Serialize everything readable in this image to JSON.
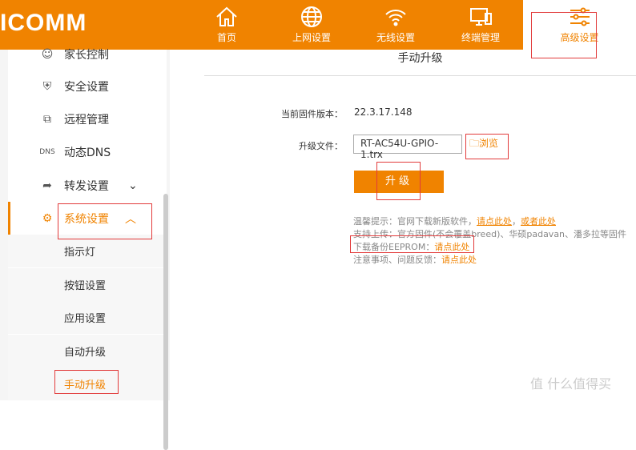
{
  "header": {
    "logo": "ICOMM",
    "nav": [
      {
        "label": "首页",
        "icon": "home-icon"
      },
      {
        "label": "上网设置",
        "icon": "globe-icon"
      },
      {
        "label": "无线设置",
        "icon": "wifi-icon"
      },
      {
        "label": "终端管理",
        "icon": "devices-icon"
      },
      {
        "label": "高级设置",
        "icon": "sliders-icon",
        "active": true
      }
    ]
  },
  "sidebar": {
    "items": [
      {
        "label": "家长控制",
        "icon": "parent-icon"
      },
      {
        "label": "安全设置",
        "icon": "shield-icon"
      },
      {
        "label": "远程管理",
        "icon": "remote-icon"
      },
      {
        "label": "动态DNS",
        "icon": "DNS"
      },
      {
        "label": "转发设置",
        "icon": "forward-icon"
      },
      {
        "label": "系统设置",
        "icon": "gear-icon"
      }
    ],
    "subitems": [
      "指示灯",
      "按钮设置",
      "应用设置",
      "自动升级",
      "手动升级"
    ]
  },
  "main": {
    "title": "手动升级",
    "fw_label": "当前固件版本：",
    "fw_value": "22.3.17.148",
    "file_label": "升级文件：",
    "file_value": "RT-AC54U-GPIO-1.trx",
    "browse": "浏览",
    "upgrade": "升级",
    "tips": {
      "l1": "温馨提示：官网下载新版软件，",
      "l1a": "请点此处",
      "l1sep": "，",
      "l1b": "或者此处",
      "l2": "支持上传：官方固件(不会覆盖breed)、华硕padavan、潘多拉等固件",
      "l3": "下载备份EEPROM：",
      "l3a": "请点此处",
      "l4": "注意事项、问题反馈：",
      "l4a": "请点此处"
    }
  },
  "watermark": "值 什么值得买",
  "colors": {
    "accent": "#f08300",
    "annotation": "#e23b3b"
  }
}
